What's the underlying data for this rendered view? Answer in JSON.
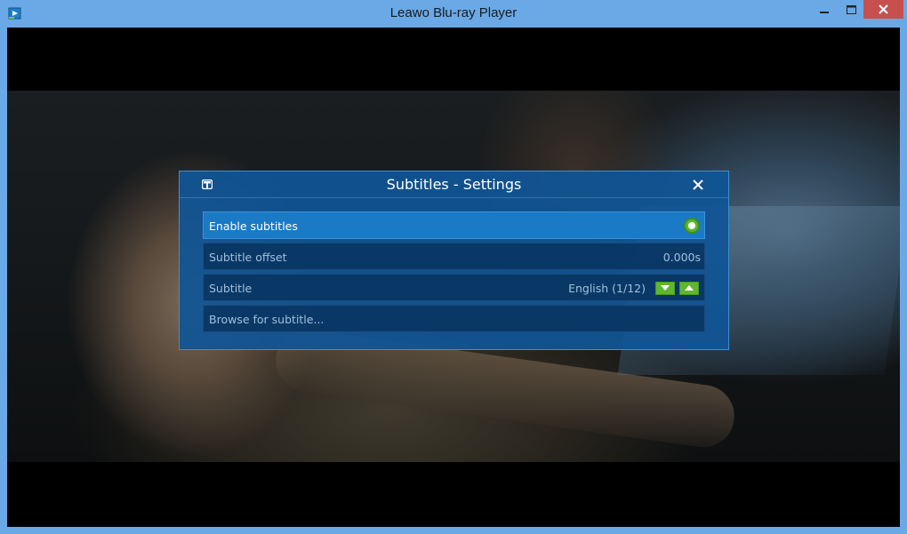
{
  "window": {
    "title": "Leawo Blu-ray Player"
  },
  "dialog": {
    "title": "Subtitles - Settings",
    "rows": [
      {
        "label": "Enable subtitles",
        "value": ""
      },
      {
        "label": "Subtitle offset",
        "value": "0.000s"
      },
      {
        "label": "Subtitle",
        "value": "English (1/12)"
      },
      {
        "label": "Browse for subtitle...",
        "value": ""
      }
    ]
  },
  "colors": {
    "titlebar": "#6aa9e6",
    "close_button": "#c7504f",
    "dialog_bg": "#1055a0",
    "selected_row": "#1a7ac6",
    "toggle_on": "#5bb82d"
  },
  "icons": {
    "app": "app-icon",
    "minimize": "minimize-icon",
    "maximize": "maximize-icon",
    "close": "close-icon",
    "dialog": "dialog-menu-icon",
    "dialog_close": "close-icon",
    "toggle": "toggle-on-icon",
    "down": "arrow-down-icon",
    "up": "arrow-up-icon"
  }
}
